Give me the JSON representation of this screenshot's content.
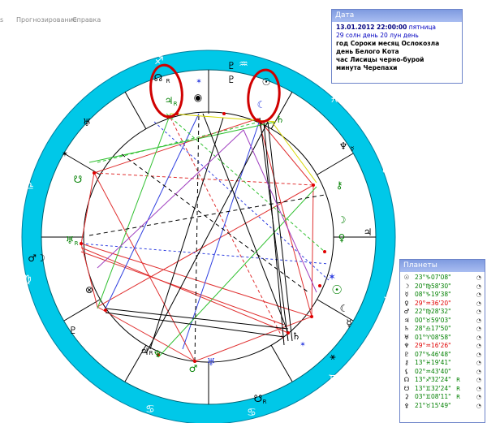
{
  "menu": [
    "Прогнозирование",
    "Справка"
  ],
  "date_panel": {
    "title": "Дата",
    "datetime": "13.01.2012  22:00:00",
    "weekday": "пятница",
    "days": "29 солн день  20 лун день",
    "lines": [
      "год Сороки        месяц Ослокозла",
      "день Белого Кота",
      "час Лисицы черно-бурой",
      "минута Черепахи"
    ]
  },
  "planets_panel": {
    "title": "Планеты",
    "rows": [
      {
        "glyph": "☉",
        "pos": "23°♑07'08\"",
        "color": "#008000",
        "retro": ""
      },
      {
        "glyph": "☽",
        "pos": "20°♍58'30\"",
        "color": "#008000",
        "retro": ""
      },
      {
        "glyph": "☿",
        "pos": "08°♑19'38\"",
        "color": "#008000",
        "retro": ""
      },
      {
        "glyph": "♀",
        "pos": "29°♒36'20\"",
        "color": "#e00000",
        "retro": ""
      },
      {
        "glyph": "♂",
        "pos": "22°♍28'32\"",
        "color": "#008000",
        "retro": ""
      },
      {
        "glyph": "♃",
        "pos": "00°♉59'03\"",
        "color": "#008000",
        "retro": ""
      },
      {
        "glyph": "♄",
        "pos": "28°♎17'50\"",
        "color": "#008000",
        "retro": ""
      },
      {
        "glyph": "♅",
        "pos": "01°♈08'58\"",
        "color": "#008000",
        "retro": ""
      },
      {
        "glyph": "♆",
        "pos": "29°♒16'26\"",
        "color": "#e00000",
        "retro": ""
      },
      {
        "glyph": "♇",
        "pos": "07°♑46'48\"",
        "color": "#008000",
        "retro": ""
      },
      {
        "glyph": "⚷",
        "pos": "13°♓19'41\"",
        "color": "#008000",
        "retro": ""
      },
      {
        "glyph": "⚸",
        "pos": "02°♒43'40\"",
        "color": "#008000",
        "retro": ""
      },
      {
        "glyph": "☊",
        "pos": "13°♐32'24\"",
        "color": "#008000",
        "retro": "R"
      },
      {
        "glyph": "☋",
        "pos": "13°♊32'24\"",
        "color": "#008000",
        "retro": "R"
      },
      {
        "glyph": "⚳",
        "pos": "03°♊08'11\"",
        "color": "#008000",
        "retro": "R"
      },
      {
        "glyph": "⚴",
        "pos": "21°♉15'49\"",
        "color": "#008000",
        "retro": ""
      }
    ]
  },
  "colors": {
    "ring": "#00c8e8",
    "wheel_bg": "#ffffff",
    "highlight": "#d00000",
    "aspect_red": "#e03030",
    "aspect_blue": "#3040e0",
    "aspect_green": "#30c030",
    "aspect_black": "#000000",
    "aspect_yellow": "#d8d800",
    "aspect_purple": "#a040c0",
    "dot_red": "#e00000"
  }
}
